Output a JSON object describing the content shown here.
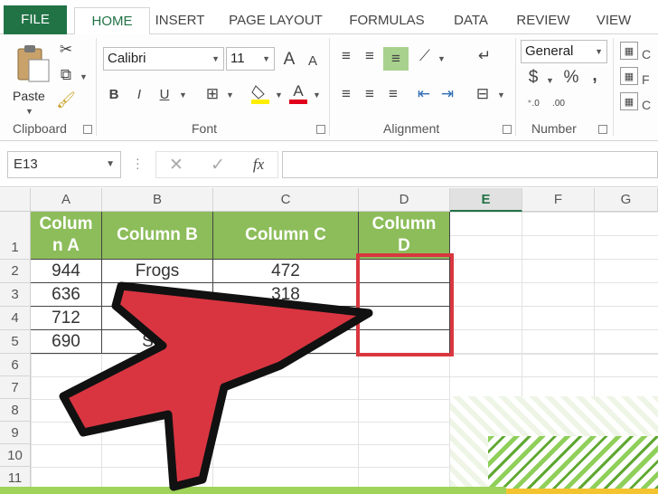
{
  "tabs": [
    "FILE",
    "HOME",
    "INSERT",
    "PAGE LAYOUT",
    "FORMULAS",
    "DATA",
    "REVIEW",
    "VIEW"
  ],
  "clipboard": {
    "paste_label": "Paste",
    "group_label": "Clipboard"
  },
  "font": {
    "name": "Calibri",
    "size": "11",
    "group_label": "Font",
    "bold": "B",
    "italic": "I",
    "underline": "U",
    "grow": "A",
    "shrink": "A",
    "color_glyph": "A"
  },
  "alignment": {
    "group_label": "Alignment"
  },
  "number": {
    "format": "General",
    "group_label": "Number",
    "currency": "$",
    "percent": "%",
    "comma": ","
  },
  "formula_bar": {
    "name_box": "E13",
    "fx": "fx",
    "value": ""
  },
  "columns": [
    "A",
    "B",
    "C",
    "D",
    "E",
    "F",
    "G"
  ],
  "rows": [
    "1",
    "2",
    "3",
    "4",
    "5",
    "6",
    "7",
    "8",
    "9",
    "10",
    "11"
  ],
  "table": {
    "headers": [
      "Colum n A",
      "Column B",
      "Column C",
      "Column D"
    ],
    "rows": [
      [
        "944",
        "Frogs",
        "472"
      ],
      [
        "636",
        "",
        "318"
      ],
      [
        "712",
        "",
        ""
      ],
      [
        "690",
        "Sna",
        ""
      ]
    ]
  },
  "colors": {
    "accent": "#217346",
    "header_fill": "#8cbd5a",
    "highlight": "#d9373f"
  }
}
